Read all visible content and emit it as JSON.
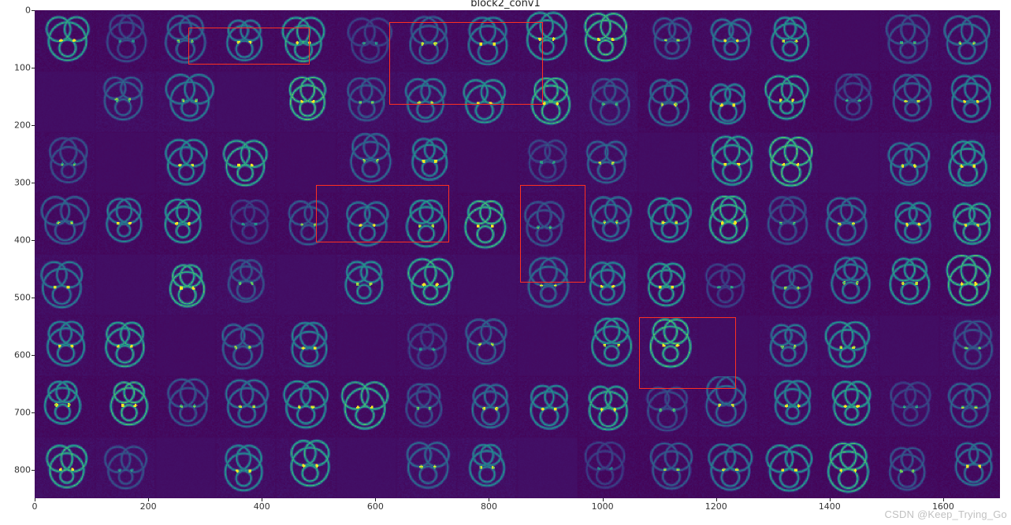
{
  "chart_data": {
    "type": "heatmap",
    "title": "block2_conv1",
    "xlabel": "",
    "ylabel": "",
    "xlim": [
      0,
      1700
    ],
    "ylim": [
      850,
      0
    ],
    "x_ticks": [
      0,
      200,
      400,
      600,
      800,
      1000,
      1200,
      1400,
      1600
    ],
    "y_ticks": [
      0,
      100,
      200,
      300,
      400,
      500,
      600,
      700,
      800
    ],
    "grid": {
      "cols": 16,
      "rows": 8,
      "tile_w_data": 106.25,
      "tile_h_data": 106.25,
      "description": "8×16 mosaic of CNN feature-map tiles (dog face activations) rendered with viridis-like colormap, mostly dark purple with cyan edge highlights."
    },
    "annotations": [
      {
        "kind": "rect",
        "x0": 270,
        "y0": 30,
        "x1": 485,
        "y1": 95
      },
      {
        "kind": "rect",
        "x0": 625,
        "y0": 20,
        "x1": 895,
        "y1": 165
      },
      {
        "kind": "rect",
        "x0": 495,
        "y0": 305,
        "x1": 730,
        "y1": 405
      },
      {
        "kind": "rect",
        "x0": 855,
        "y0": 305,
        "x1": 970,
        "y1": 475
      },
      {
        "kind": "rect",
        "x0": 1065,
        "y0": 535,
        "x1": 1235,
        "y1": 660
      }
    ],
    "colormap": "viridis",
    "value_range_note": "Activation intensities are normalized per-tile; dark purple ≈ low, cyan/green ≈ high."
  },
  "watermark": "CSDN @Keep_Trying_Go"
}
